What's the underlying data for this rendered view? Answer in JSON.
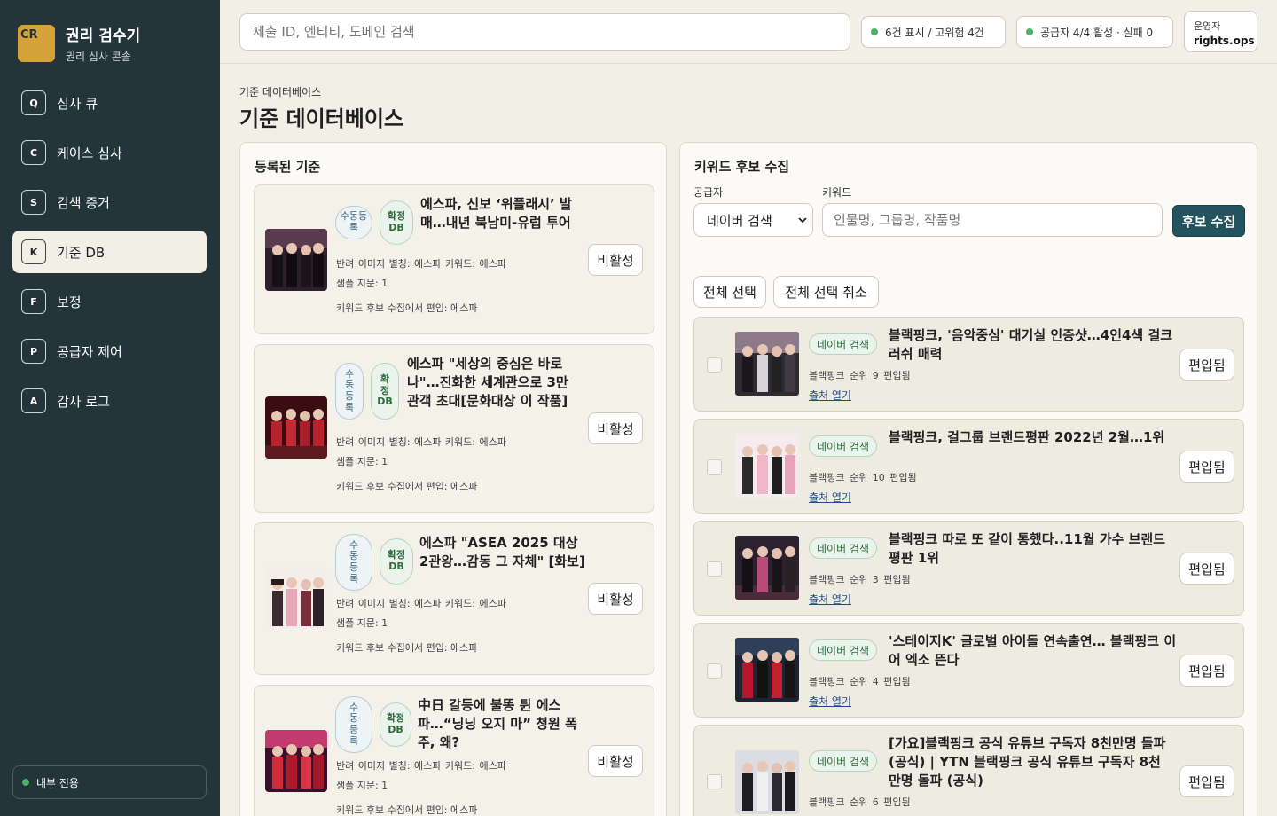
{
  "brand": {
    "logo": "CR",
    "title": "권리 검수기",
    "subtitle": "권리 심사 콘솔"
  },
  "nav": [
    {
      "key": "Q",
      "label": "심사 큐"
    },
    {
      "key": "C",
      "label": "케이스 심사"
    },
    {
      "key": "S",
      "label": "검색 증거"
    },
    {
      "key": "K",
      "label": "기준 DB"
    },
    {
      "key": "F",
      "label": "보정"
    },
    {
      "key": "P",
      "label": "공급자 제어"
    },
    {
      "key": "A",
      "label": "감사 로그"
    }
  ],
  "internal_label": "내부 전용",
  "topbar": {
    "search_placeholder": "제출 ID, 엔티티, 도메인 검색",
    "status_display": "6건 표시 / 고위험 4건",
    "status_provider": "공급자 4/4 활성 · 실패 0",
    "operator_role": "운영자",
    "operator_name": "rights.ops"
  },
  "page": {
    "breadcrumb": "기준 데이터베이스",
    "title": "기준 데이터베이스"
  },
  "references": {
    "title": "등록된 기준",
    "badge_manual": "수동등록",
    "badge_confirm": "확정DB",
    "deactivate_label": "비활성",
    "items": [
      {
        "title": "에스파, 신보 ‘위플래시’ 발매…내년 북남미-유럽 투어",
        "meta": "반려 이미지 별칭: 에스파 키워드: 에스파",
        "sample": "샘플 지문: 1",
        "note": "키워드 후보 수집에서 편입: 에스파"
      },
      {
        "title": "에스파 \"세상의 중심은 바로 나\"…진화한 세계관으로 3만 관객 초대[문화대상 이 작품]",
        "meta": "반려 이미지 별칭: 에스파 키워드: 에스파",
        "sample": "샘플 지문: 1",
        "note": "키워드 후보 수집에서 편입: 에스파"
      },
      {
        "title": "에스파 \"ASEA 2025 대상 2관왕…감동 그 자체\" [화보]",
        "meta": "반려 이미지 별칭: 에스파 키워드: 에스파",
        "sample": "샘플 지문: 1",
        "note": "키워드 후보 수집에서 편입: 에스파"
      },
      {
        "title": "中日 갈등에 불똥 튄 에스파…“닝닝 오지 마” 청원 폭주, 왜?",
        "meta": "반려 이미지 별칭: 에스파 키워드: 에스파",
        "sample": "샘플 지문: 1",
        "note": "키워드 후보 수집에서 편입: 에스파"
      }
    ]
  },
  "collect": {
    "title": "키워드 후보 수집",
    "provider_label": "공급자",
    "provider_value": "네이버 검색",
    "keyword_label": "키워드",
    "keyword_placeholder": "인물명, 그룹명, 작품명",
    "submit_label": "후보 수집",
    "select_all": "전체 선택",
    "deselect_all": "전체 선택 취소",
    "source_badge": "네이버 검색",
    "link_label": "출처 열기",
    "included_label": "편입됨",
    "candidates": [
      {
        "title": "블랙핑크, '음악중심' 대기실 인증샷…4인4색 걸크러쉬 매력",
        "meta": "블랙핑크 순위 9 편입됨"
      },
      {
        "title": "블랙핑크, 걸그룹 브랜드평판 2022년 2월…1위",
        "meta": "블랙핑크 순위 10 편입됨"
      },
      {
        "title": "블랙핑크 따로 또 같이 통했다..11월 가수 브랜드평판 1위",
        "meta": "블랙핑크 순위 3 편입됨"
      },
      {
        "title": "'스테이지K' 글로벌 아이돌 연속출연… 블랙핑크 이어 엑소 뜬다",
        "meta": "블랙핑크 순위 4 편입됨"
      },
      {
        "title": "[가요]블랙핑크 공식 유튜브 구독자 8천만명 돌파 (공식) | YTN 블랙핑크 공식 유튜브 구독자 8천만명 돌파 (공식)",
        "meta": "블랙핑크 순위 6 편입됨"
      }
    ]
  },
  "colors": {
    "sidebar": "#23343a",
    "accent": "#23535f",
    "logo": "#d5a23a",
    "status": "#4caf6a"
  }
}
